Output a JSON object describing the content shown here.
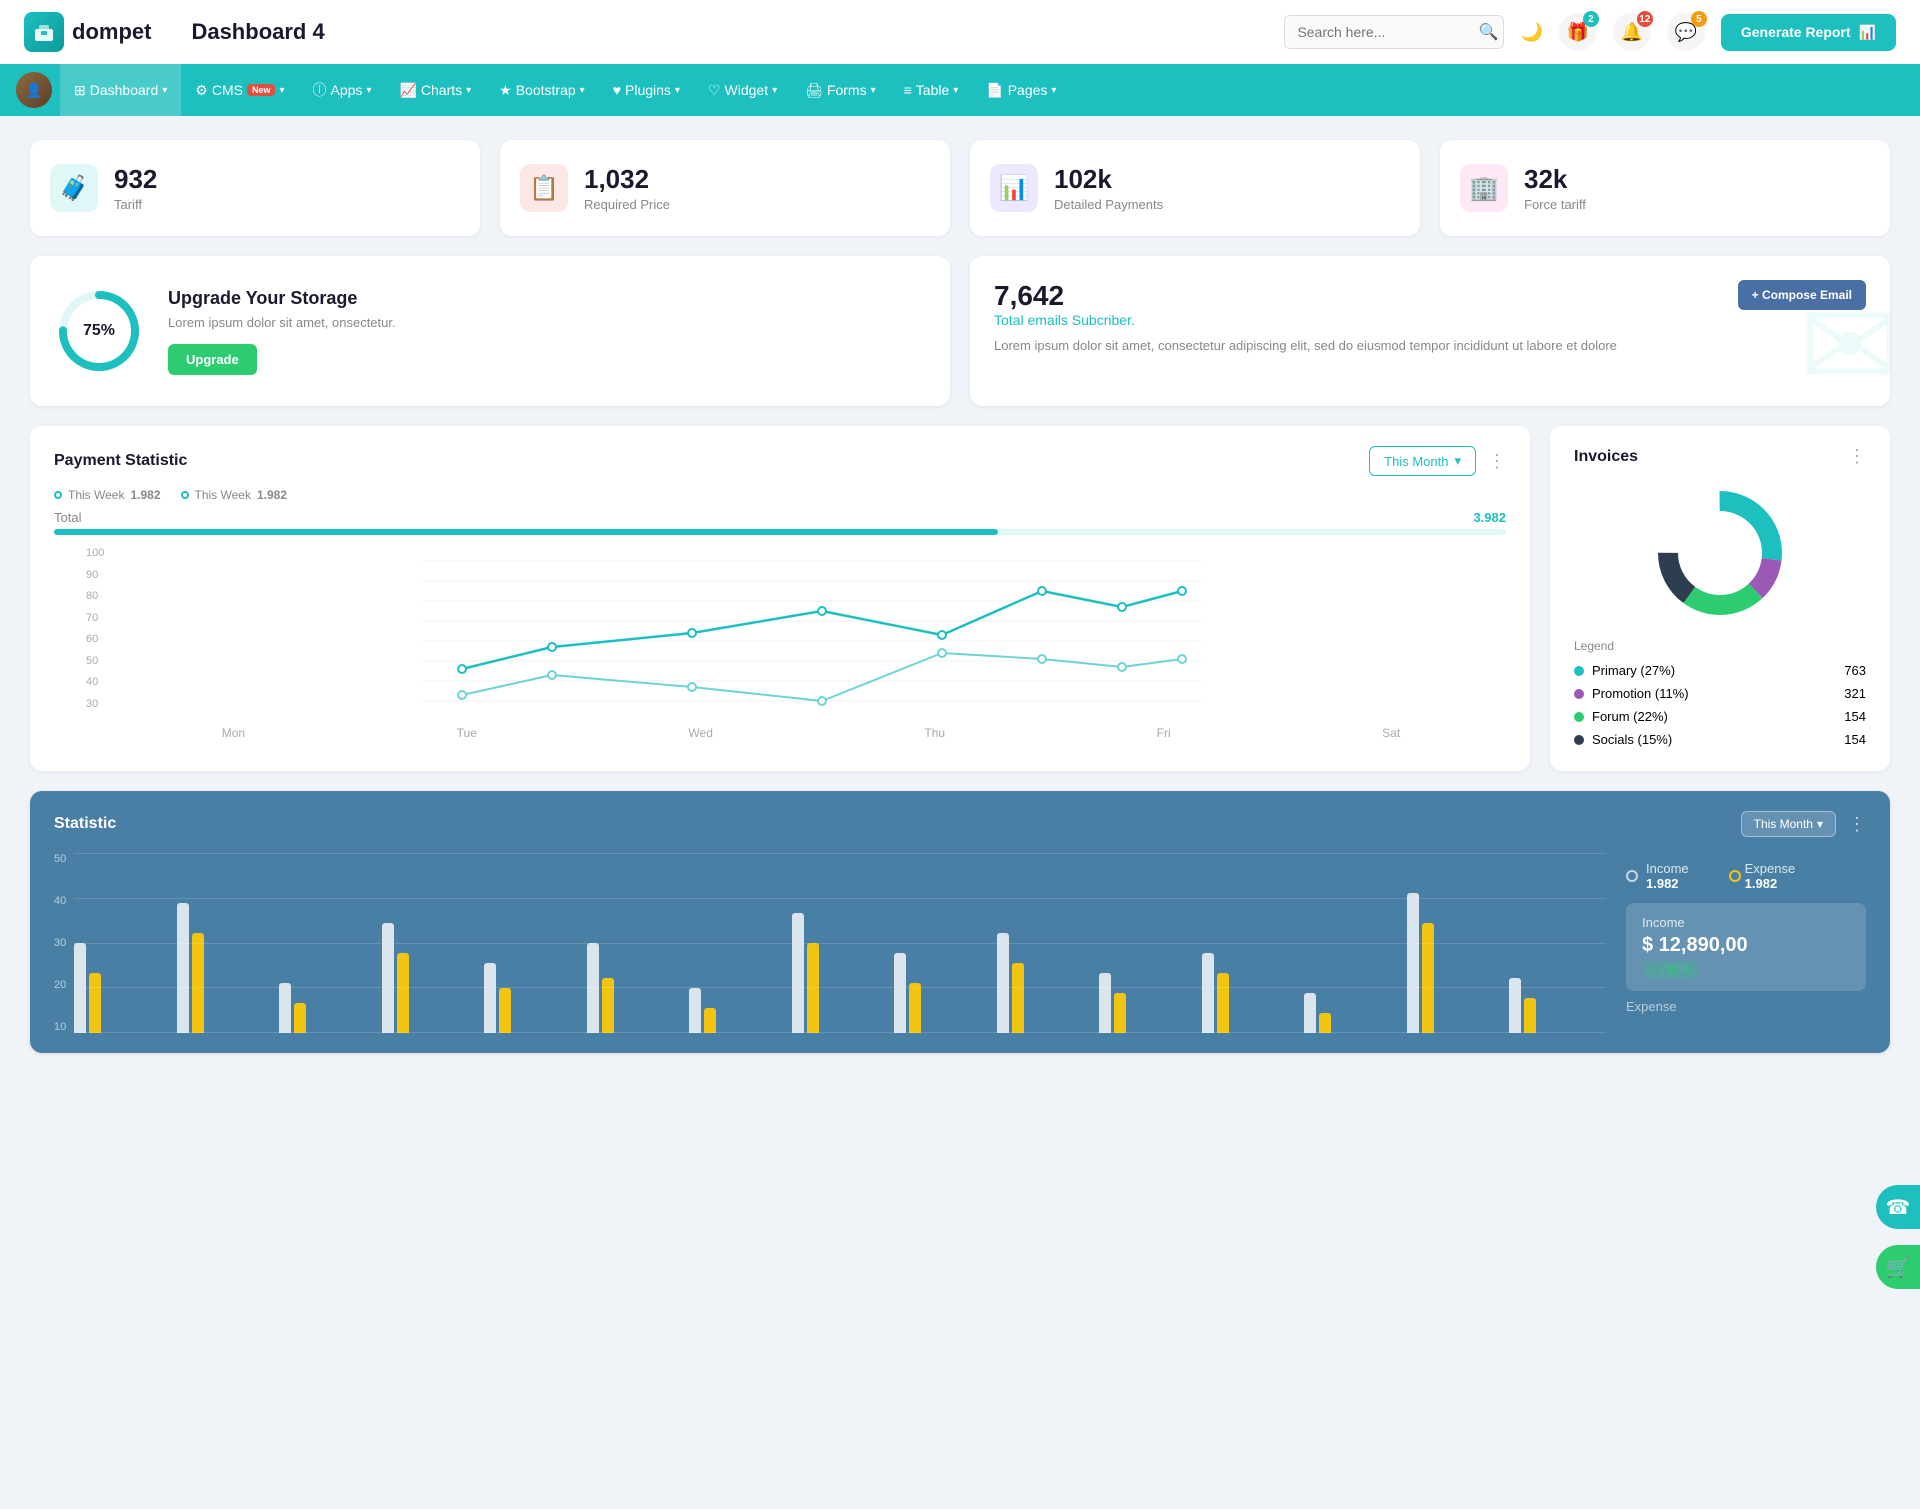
{
  "header": {
    "logo_letter": "c",
    "logo_name": "dompet",
    "page_title": "Dashboard 4",
    "search_placeholder": "Search here...",
    "generate_btn": "Generate Report",
    "badge_gift": "2",
    "badge_bell": "12",
    "badge_chat": "5"
  },
  "nav": {
    "items": [
      {
        "label": "Dashboard",
        "icon": "⊞",
        "has_arrow": true,
        "active": true
      },
      {
        "label": "CMS",
        "icon": "⚙",
        "has_arrow": true,
        "badge_new": true
      },
      {
        "label": "Apps",
        "icon": "ⓘ",
        "has_arrow": true
      },
      {
        "label": "Charts",
        "icon": "📈",
        "has_arrow": true
      },
      {
        "label": "Bootstrap",
        "icon": "★",
        "has_arrow": true
      },
      {
        "label": "Plugins",
        "icon": "♥",
        "has_arrow": true
      },
      {
        "label": "Widget",
        "icon": "♥",
        "has_arrow": true
      },
      {
        "label": "Forms",
        "icon": "🖨",
        "has_arrow": true
      },
      {
        "label": "Table",
        "icon": "≡",
        "has_arrow": true
      },
      {
        "label": "Pages",
        "icon": "📄",
        "has_arrow": true
      }
    ]
  },
  "stat_cards": [
    {
      "value": "932",
      "label": "Tariff",
      "icon": "🧳",
      "color": "teal"
    },
    {
      "value": "1,032",
      "label": "Required Price",
      "icon": "📋",
      "color": "red"
    },
    {
      "value": "102k",
      "label": "Detailed Payments",
      "icon": "📊",
      "color": "purple"
    },
    {
      "value": "32k",
      "label": "Force tariff",
      "icon": "🏢",
      "color": "pink"
    }
  ],
  "storage": {
    "percent": 75,
    "percent_label": "75%",
    "title": "Upgrade Your Storage",
    "desc": "Lorem ipsum dolor sit amet, onsectetur.",
    "btn_label": "Upgrade"
  },
  "email": {
    "count": "7,642",
    "label": "Total emails Subcriber.",
    "desc": "Lorem ipsum dolor sit amet, consectetur adipiscing elit, sed do eiusmod tempor incididunt ut labore et dolore",
    "compose_btn": "+ Compose Email"
  },
  "payment_statistic": {
    "title": "Payment Statistic",
    "this_month_btn": "This Month",
    "legend": [
      {
        "label": "This Week",
        "value": "1.982"
      },
      {
        "label": "This Week",
        "value": "1.982"
      }
    ],
    "total_label": "Total",
    "total_value": "3.982",
    "progress_pct": 65,
    "x_labels": [
      "Mon",
      "Tue",
      "Wed",
      "Thu",
      "Fri",
      "Sat"
    ],
    "y_labels": [
      "100",
      "90",
      "80",
      "70",
      "60",
      "50",
      "40",
      "30"
    ],
    "line1_points": "40,168 100,148 210,130 350,108 490,132 570,108 640,120 760,108",
    "line2_points": "40,148 100,132 210,148 350,160 490,110 570,118 640,120 760,118"
  },
  "invoices": {
    "title": "Invoices",
    "legend": [
      {
        "label": "Primary (27%)",
        "value": "763",
        "color": "#1dbfbf"
      },
      {
        "label": "Promotion (11%)",
        "value": "321",
        "color": "#9b59b6"
      },
      {
        "label": "Forum (22%)",
        "value": "154",
        "color": "#2ecc71"
      },
      {
        "label": "Socials (15%)",
        "value": "154",
        "color": "#2c3e50"
      }
    ],
    "legend_title": "Legend"
  },
  "statistic": {
    "title": "Statistic",
    "this_month_btn": "This Month",
    "income_label": "Income",
    "income_value": "1.982",
    "expense_label": "Expense",
    "expense_value": "1.982",
    "income_box_title": "Income",
    "income_amount": "$ 12,890,00",
    "income_change": "+15%"
  },
  "fabs": {
    "support_icon": "☎",
    "cart_icon": "🛒"
  }
}
